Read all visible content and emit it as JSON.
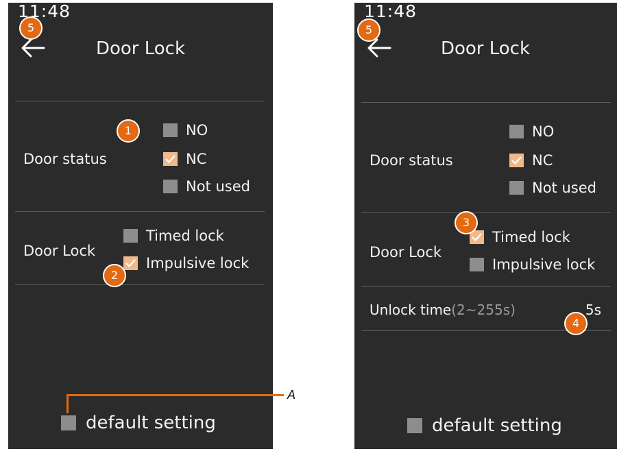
{
  "left": {
    "status_time": "11:48",
    "title": "Door Lock",
    "door_status_label": "Door status",
    "door_status_options": [
      {
        "label": "NO",
        "checked": false
      },
      {
        "label": "NC",
        "checked": true
      },
      {
        "label": "Not used",
        "checked": false
      }
    ],
    "door_lock_label": "Door Lock",
    "door_lock_options": [
      {
        "label": "Timed lock",
        "checked": false
      },
      {
        "label": "Impulsive lock",
        "checked": true
      }
    ],
    "default_setting_label": "default setting",
    "default_setting_checked": false
  },
  "right": {
    "status_time": "11:48",
    "title": "Door Lock",
    "door_status_label": "Door status",
    "door_status_options": [
      {
        "label": "NO",
        "checked": false
      },
      {
        "label": "NC",
        "checked": true
      },
      {
        "label": "Not used",
        "checked": false
      }
    ],
    "door_lock_label": "Door Lock",
    "door_lock_options": [
      {
        "label": "Timed lock",
        "checked": true
      },
      {
        "label": "Impulsive lock",
        "checked": false
      }
    ],
    "unlock_time_label": "Unlock time",
    "unlock_time_range": "(2~255s)",
    "unlock_time_value": "5s",
    "default_setting_label": "default setting",
    "default_setting_checked": false
  },
  "annotations": {
    "badge_1": "1",
    "badge_2": "2",
    "badge_3": "3",
    "badge_4": "4",
    "badge_5": "5",
    "callout_a": "A"
  },
  "colors": {
    "screen_bg": "#2b2b2b",
    "checked_box": "#f0b98a",
    "unchecked_box": "#8d8d8d",
    "badge": "#e36a12"
  },
  "icons": [
    "back-arrow-icon",
    "check-icon"
  ]
}
